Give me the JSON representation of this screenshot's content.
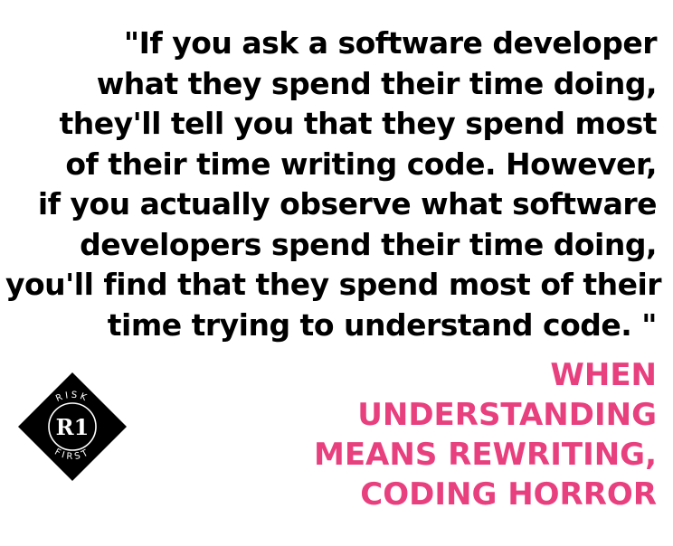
{
  "quote": {
    "lines": [
      "\"If you ask a software developer",
      "what they spend their time doing,",
      "they'll tell you that they spend most",
      "of their time writing code. However,",
      "if you actually observe what software",
      "developers spend their time doing,",
      "you'll find that they spend most of their",
      "time trying to understand code. \""
    ]
  },
  "source": {
    "lines": [
      "WHEN",
      "UNDERSTANDING",
      "MEANS REWRITING,",
      "CODING HORROR"
    ],
    "color": "#e8407f"
  },
  "logo": {
    "top_text": "RISK",
    "bottom_text": "FIRST",
    "monogram": "R1"
  }
}
